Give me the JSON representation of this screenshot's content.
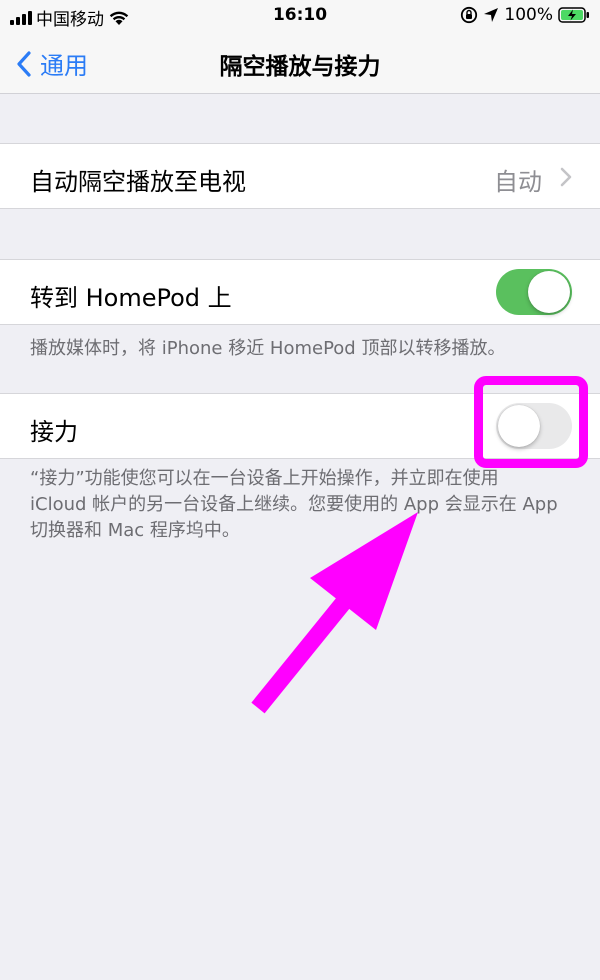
{
  "status_bar": {
    "carrier": "中国移动",
    "time": "16:10",
    "battery": "100%"
  },
  "nav": {
    "back_label": "通用",
    "title": "隔空播放与接力"
  },
  "airplay_row": {
    "label": "自动隔空播放至电视",
    "value": "自动"
  },
  "homepod_row": {
    "label": "转到 HomePod 上",
    "toggle_on": true,
    "note": "播放媒体时，将 iPhone 移近 HomePod 顶部以转移播放。"
  },
  "handoff_row": {
    "label": "接力",
    "toggle_on": false,
    "note_line1": "“接力”功能使您可以在一台设备上开始操作，并立即在使用",
    "note_line2": "iCloud 帐户的另一台设备上继续。您要使用的 App 会显示在 App",
    "note_line3": "切换器和 Mac 程序坞中。"
  },
  "colors": {
    "accent": "#2b7cf6",
    "toggle_on": "#5ac05e",
    "annotation": "#ff00ff",
    "background": "#efeff4"
  }
}
